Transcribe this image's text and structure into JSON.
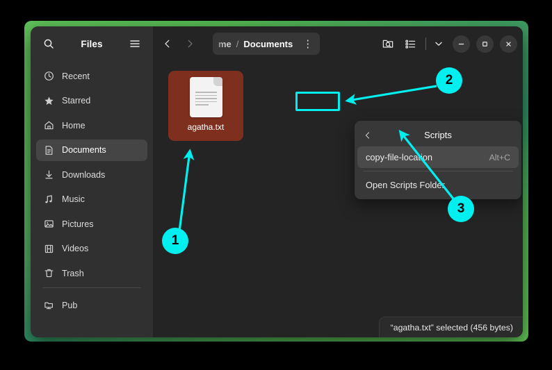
{
  "window": {
    "app_title": "Files",
    "search_icon": "search-icon",
    "menu_icon": "hamburger-menu-icon"
  },
  "sidebar": {
    "items": [
      {
        "label": "Recent",
        "icon": "clock-icon",
        "selected": false
      },
      {
        "label": "Starred",
        "icon": "star-icon",
        "selected": false
      },
      {
        "label": "Home",
        "icon": "home-icon",
        "selected": false
      },
      {
        "label": "Documents",
        "icon": "document-icon",
        "selected": true
      },
      {
        "label": "Downloads",
        "icon": "download-icon",
        "selected": false
      },
      {
        "label": "Music",
        "icon": "music-note-icon",
        "selected": false
      },
      {
        "label": "Pictures",
        "icon": "image-icon",
        "selected": false
      },
      {
        "label": "Videos",
        "icon": "film-icon",
        "selected": false
      },
      {
        "label": "Trash",
        "icon": "trash-icon",
        "selected": false
      }
    ],
    "bookmarks": [
      {
        "label": "Pub",
        "icon": "network-folder-icon",
        "selected": false
      }
    ]
  },
  "header": {
    "back_icon": "chevron-left-icon",
    "forward_icon": "chevron-right-icon",
    "breadcrumb": {
      "truncated_parent": "me",
      "separator": "/",
      "current": "Documents",
      "overflow_icon": "vertical-dots-icon"
    },
    "search_folder_icon": "folder-search-icon",
    "view_list_icon": "list-view-icon",
    "view_dropdown_icon": "chevron-down-icon",
    "minimize_icon": "minimize-icon",
    "maximize_icon": "maximize-icon",
    "close_icon": "close-icon"
  },
  "content": {
    "file": {
      "name": "agatha.txt",
      "icon": "text-document-icon",
      "selected": true,
      "selection_color": "#7e2f1d"
    }
  },
  "popup": {
    "back_icon": "chevron-left-icon",
    "title": "Scripts",
    "items": [
      {
        "label": "copy-file-location",
        "accel": "Alt+C",
        "hovered": true
      },
      {
        "label": "Open Scripts Folder",
        "accel": "",
        "hovered": false
      }
    ]
  },
  "statusbar": {
    "text": "“agatha.txt” selected  (456 bytes)"
  },
  "annotations": {
    "accent_color": "#00f0f0",
    "badges": [
      {
        "label": "1"
      },
      {
        "label": "2"
      },
      {
        "label": "3"
      }
    ]
  }
}
